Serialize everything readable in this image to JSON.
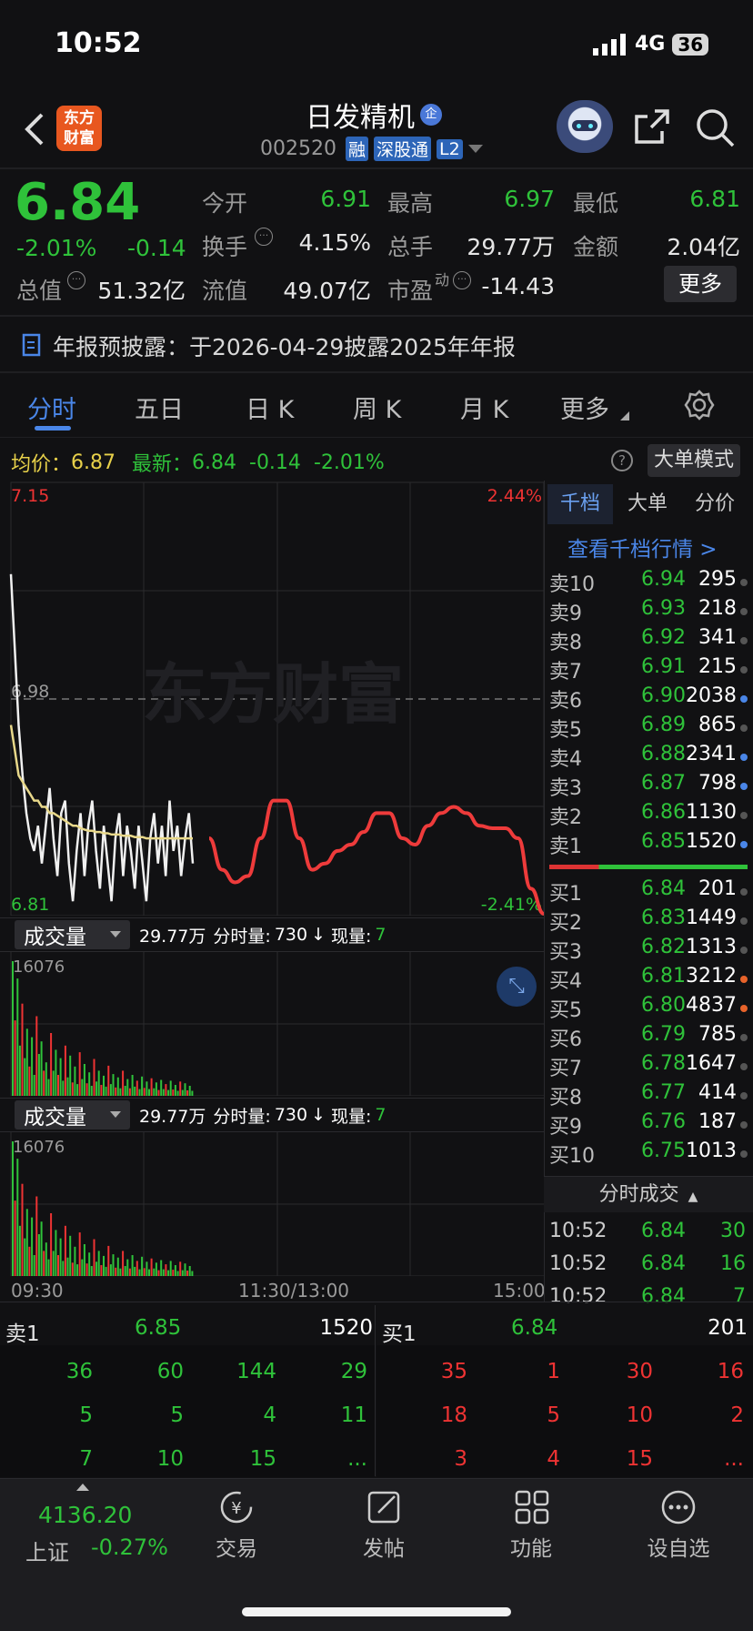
{
  "status": {
    "time": "10:52",
    "network": "4G",
    "battery": "36"
  },
  "header": {
    "logo_text": "东方\n财富",
    "title": "日发精机",
    "title_badge": "企",
    "code": "002520",
    "tags": [
      "融",
      "深股通",
      "L2"
    ]
  },
  "quote": {
    "price": "6.84",
    "change_pct": "-2.01%",
    "change": "-0.14",
    "open_label": "今开",
    "open": "6.91",
    "high_label": "最高",
    "high": "6.97",
    "low_label": "最低",
    "low": "6.81",
    "turnover_label": "换手",
    "turnover": "4.15%",
    "volume_label": "总手",
    "volume": "29.77万",
    "amount_label": "金额",
    "amount": "2.04亿",
    "mktcap_label": "总值",
    "mktcap": "51.32亿",
    "float_label": "流值",
    "float": "49.07亿",
    "pe_label": "市盈",
    "pe_sup": "动",
    "pe": "-14.43",
    "more_label": "更多"
  },
  "notice": {
    "text": "年报预披露：于2026-04-29披露2025年年报"
  },
  "tabs": [
    "分时",
    "五日",
    "日 K",
    "周 K",
    "月 K",
    "更多"
  ],
  "info_line": {
    "avg_label": "均价：",
    "avg": "6.87",
    "latest_label": "最新：",
    "latest": "6.84",
    "change": "-0.14",
    "change_pct": "-2.01%",
    "mode_button": "大单模式"
  },
  "chart_data": {
    "type": "line",
    "y_top": "7.15",
    "y_mid": "6.98",
    "y_bottom": "6.81",
    "pct_top": "2.44%",
    "pct_bottom": "-2.41%",
    "x_labels": [
      "09:30",
      "11:30/13:00",
      "15:00"
    ],
    "watermark": "东方财富",
    "series": [
      {
        "values": [
          7.08,
          7.02,
          6.96,
          6.92,
          6.89,
          6.87,
          6.86,
          6.88,
          6.85,
          6.88,
          6.91,
          6.87,
          6.84,
          6.89,
          6.9,
          6.85,
          6.82,
          6.86,
          6.89,
          6.84,
          6.88,
          6.9,
          6.86,
          6.83,
          6.88,
          6.85,
          6.82,
          6.87,
          6.89,
          6.84,
          6.88,
          6.86,
          6.83,
          6.88,
          6.85,
          6.82,
          6.87,
          6.89,
          6.85,
          6.88,
          6.84,
          6.9,
          6.86,
          6.88,
          6.84,
          6.87,
          6.89,
          6.85
        ]
      },
      {
        "values": [
          6.96,
          6.94,
          6.92,
          6.915,
          6.91,
          6.905,
          6.9,
          6.9,
          6.895,
          6.895,
          6.89,
          6.89,
          6.888,
          6.886,
          6.884,
          6.882,
          6.88,
          6.88,
          6.878,
          6.877,
          6.876,
          6.876,
          6.875,
          6.875,
          6.874,
          6.874,
          6.873,
          6.873,
          6.873,
          6.872,
          6.872,
          6.872,
          6.871,
          6.871,
          6.871,
          6.87,
          6.87,
          6.87,
          6.87,
          6.87,
          6.87,
          6.87,
          6.87,
          6.87,
          6.87,
          6.87,
          6.87,
          6.87
        ]
      },
      {
        "values": [
          6.87,
          6.845,
          6.835,
          6.84,
          6.87,
          6.9,
          6.9,
          6.87,
          6.845,
          6.85,
          6.86,
          6.865,
          6.875,
          6.89,
          6.89,
          6.87,
          6.865,
          6.88,
          6.89,
          6.895,
          6.89,
          6.88,
          6.878,
          6.878,
          6.87,
          6.83,
          6.81
        ]
      }
    ],
    "volume": {
      "label": "成交量",
      "total": "29.77万",
      "minute_vol_label": "分时量:",
      "minute_vol": "730",
      "arrow": "↓",
      "now_vol_label": "现量:",
      "now_vol": "7",
      "max": "16076",
      "bars": [
        16076,
        9000,
        14000,
        6000,
        11000,
        4500,
        8000,
        3500,
        7000,
        2500,
        9500,
        5000,
        6500,
        3000,
        4000,
        2000,
        7500,
        3000,
        5500,
        2500,
        4500,
        1800,
        6000,
        2200,
        4800,
        1600,
        3500,
        1400,
        5200,
        2000,
        3800,
        1500,
        2800,
        1200,
        4400,
        1700,
        3000,
        1300,
        2400,
        1100,
        3600,
        1400,
        2600,
        1000,
        2200,
        900,
        3000,
        1200,
        2000,
        900,
        2500,
        1100,
        1800,
        800,
        2300,
        950,
        1700,
        800,
        2100,
        900,
        1600,
        700,
        1900,
        800,
        1400,
        700,
        1800,
        750,
        1300,
        600,
        1700,
        700,
        1500,
        650,
        1200,
        600
      ]
    }
  },
  "orderbook": {
    "tabs": [
      "千档",
      "大单",
      "分价"
    ],
    "view_more": "查看千档行情 >",
    "asks": [
      {
        "label": "卖10",
        "price": "6.94",
        "vol": "295",
        "dot": "gray"
      },
      {
        "label": "卖9",
        "price": "6.93",
        "vol": "218",
        "dot": "gray"
      },
      {
        "label": "卖8",
        "price": "6.92",
        "vol": "341",
        "dot": "gray"
      },
      {
        "label": "卖7",
        "price": "6.91",
        "vol": "215",
        "dot": "gray"
      },
      {
        "label": "卖6",
        "price": "6.90",
        "vol": "2038",
        "dot": "blue"
      },
      {
        "label": "卖5",
        "price": "6.89",
        "vol": "865",
        "dot": "gray"
      },
      {
        "label": "卖4",
        "price": "6.88",
        "vol": "2341",
        "dot": "blue"
      },
      {
        "label": "卖3",
        "price": "6.87",
        "vol": "798",
        "dot": "blue"
      },
      {
        "label": "卖2",
        "price": "6.86",
        "vol": "1130",
        "dot": "gray"
      },
      {
        "label": "卖1",
        "price": "6.85",
        "vol": "1520",
        "dot": "blue"
      }
    ],
    "bids": [
      {
        "label": "买1",
        "price": "6.84",
        "vol": "201",
        "dot": "gray"
      },
      {
        "label": "买2",
        "price": "6.83",
        "vol": "1449",
        "dot": "gray"
      },
      {
        "label": "买3",
        "price": "6.82",
        "vol": "1313",
        "dot": "gray"
      },
      {
        "label": "买4",
        "price": "6.81",
        "vol": "3212",
        "dot": "orange"
      },
      {
        "label": "买5",
        "price": "6.80",
        "vol": "4837",
        "dot": "orange"
      },
      {
        "label": "买6",
        "price": "6.79",
        "vol": "785",
        "dot": "gray"
      },
      {
        "label": "买7",
        "price": "6.78",
        "vol": "1647",
        "dot": "gray"
      },
      {
        "label": "买8",
        "price": "6.77",
        "vol": "414",
        "dot": "gray"
      },
      {
        "label": "买9",
        "price": "6.76",
        "vol": "187",
        "dot": "gray"
      },
      {
        "label": "买10",
        "price": "6.75",
        "vol": "1013",
        "dot": "gray"
      }
    ],
    "trades_title": "分时成交",
    "trades": [
      {
        "time": "10:52",
        "price": "6.84",
        "vol": "30"
      },
      {
        "time": "10:52",
        "price": "6.84",
        "vol": "16"
      },
      {
        "time": "10:52",
        "price": "6.84",
        "vol": "7"
      }
    ]
  },
  "queue": {
    "sell_label": "卖1",
    "sell_price": "6.85",
    "sell_vol": "1520",
    "buy_label": "买1",
    "buy_price": "6.84",
    "buy_vol": "201",
    "sell_rows": [
      [
        "36",
        "60",
        "144",
        "29"
      ],
      [
        "5",
        "5",
        "4",
        "11"
      ],
      [
        "7",
        "10",
        "15",
        "..."
      ]
    ],
    "buy_rows": [
      [
        "35",
        "1",
        "30",
        "16"
      ],
      [
        "18",
        "5",
        "10",
        "2"
      ],
      [
        "3",
        "4",
        "15",
        "..."
      ]
    ]
  },
  "bottom_nav": {
    "index_value": "4136.20",
    "index_name": "上证",
    "index_change": "-0.27%",
    "items": [
      "交易",
      "发帖",
      "功能",
      "设自选"
    ]
  },
  "colors": {
    "up": "#ee3333",
    "down": "#2fc23a",
    "avg": "#e8d14a",
    "accent": "#4a86e8"
  }
}
